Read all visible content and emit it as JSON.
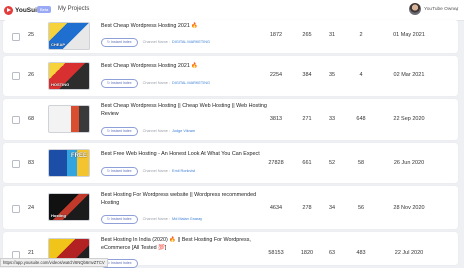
{
  "header": {
    "logo_text": "YouSuite",
    "beta_label": "Beta",
    "nav_my_projects": "My Projects",
    "user_name": "YouTube Owner",
    "user_chevron": "▾"
  },
  "common": {
    "instant_index_label": "↻ Instant Index",
    "channel_label": "Channel Name :"
  },
  "rows": [
    {
      "num": "25",
      "title": "Best Cheap Wordpress Hosting 2021 🔥",
      "channel": "DIGITAL MARKETING",
      "thumb_text": "CHEAP",
      "v1": "1872",
      "v2": "265",
      "v3": "31",
      "v4": "2",
      "date": "01 May 2021"
    },
    {
      "num": "26",
      "title": "Best Cheap Wordpress Hosting 2021 🔥",
      "channel": "DIGITAL MARKETING",
      "thumb_text": "HOSTING",
      "v1": "2254",
      "v2": "384",
      "v3": "35",
      "v4": "4",
      "date": "02 Mar 2021"
    },
    {
      "num": "68",
      "title": "Best Cheap Wordpress Hosting || Cheap Web Hosting || Web Hosting Review",
      "channel": "Judge Vikram",
      "thumb_text": "",
      "v1": "3813",
      "v2": "271",
      "v3": "33",
      "v4": "648",
      "date": "22 Sep 2020"
    },
    {
      "num": "83",
      "title": "Best Free Web Hosting - An Honest Look At What You Can Expect",
      "channel": "Emil Ronkvist",
      "thumb_text": "FREE",
      "v1": "27828",
      "v2": "661",
      "v3": "52",
      "v4": "58",
      "date": "26 Jun 2020"
    },
    {
      "num": "24",
      "title": "Best Hosting For Wordpress website || Wordpress recommended Hosting",
      "channel": "Md Malan Gnaray",
      "thumb_text": "Hosting",
      "v1": "4634",
      "v2": "278",
      "v3": "34",
      "v4": "56",
      "date": "28 Nov 2020"
    },
    {
      "num": "21",
      "title": "Best Hosting In India (2020) 🔥 || Best Hosting For Wordpress, eCommerce [All Tested 💯]",
      "channel": "",
      "thumb_text": "",
      "v1": "58153",
      "v2": "1820",
      "v3": "63",
      "v4": "483",
      "date": "22 Jul 2020"
    }
  ],
  "status_bar": {
    "url": "https://app.yousuite.com/videos/watch/6NQb6mvZTCV"
  },
  "colors": {
    "brand_red": "#e43d3d",
    "link_blue": "#3c7fd6",
    "button_border": "#8fa0d8"
  }
}
